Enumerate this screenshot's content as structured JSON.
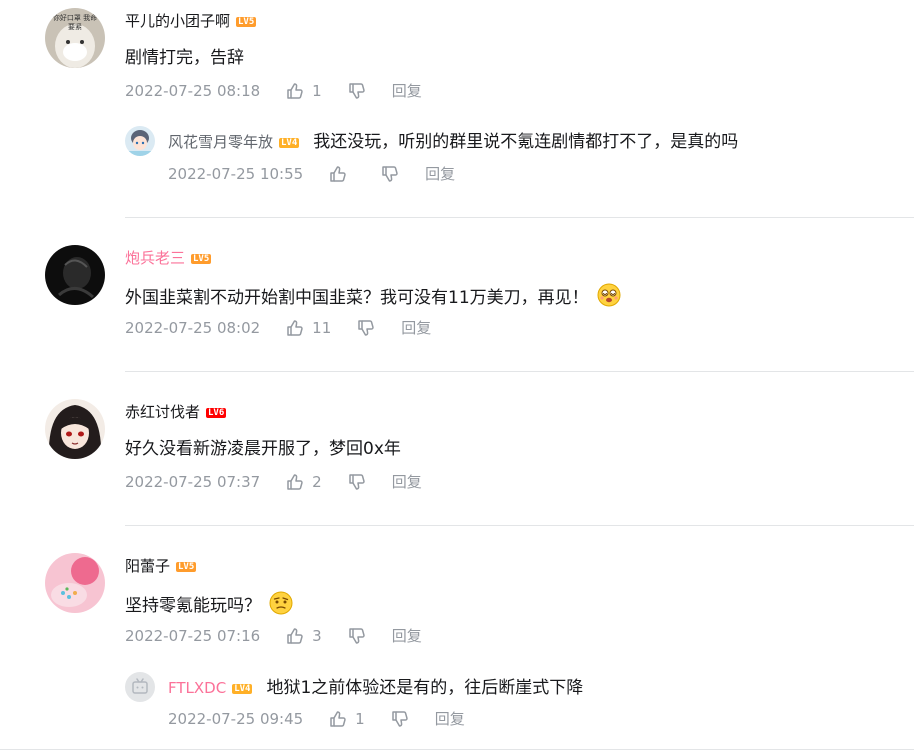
{
  "comments": [
    {
      "username": "平儿的小团子啊",
      "level": "LV5",
      "avatar_text": "你好口罩 我命要紧",
      "content": "剧情打完，告辞",
      "time": "2022-07-25 08:18",
      "likes": "1",
      "reply_label": "回复",
      "replies": [
        {
          "username": "风花雪月零年放",
          "level": "LV4",
          "content": "我还没玩，听别的群里说不氪连剧情都打不了，是真的吗",
          "time": "2022-07-25 10:55",
          "likes": "",
          "reply_label": "回复"
        }
      ]
    },
    {
      "username": "炮兵老三",
      "level": "LV5",
      "content": "外国韭菜割不动开始割中国韭菜？我可没有11万美刀，再见！",
      "emoji": "dizzy-face-emoji",
      "time": "2022-07-25 08:02",
      "likes": "11",
      "reply_label": "回复"
    },
    {
      "username": "赤红讨伐者",
      "level": "LV6",
      "content": "好久没看新游凌晨开服了，梦回0x年",
      "time": "2022-07-25 07:37",
      "likes": "2",
      "reply_label": "回复"
    },
    {
      "username": "阳蕾子",
      "level": "LV5",
      "content": "坚持零氪能玩吗？",
      "emoji": "thinking-face-emoji",
      "time": "2022-07-25 07:16",
      "likes": "3",
      "reply_label": "回复",
      "replies": [
        {
          "username": "FTLXDC",
          "level": "LV4",
          "content": "地狱1之前体验还是有的，往后断崖式下降",
          "time": "2022-07-25 09:45",
          "likes": "1",
          "reply_label": "回复"
        }
      ]
    }
  ],
  "colors": {
    "text": "#18191c",
    "meta": "#9499a0",
    "vip_pink": "#fb7299",
    "level5": "#ff9c2c",
    "level6": "#ff0000",
    "level4": "#ffb027",
    "divider": "#e3e5e7"
  }
}
